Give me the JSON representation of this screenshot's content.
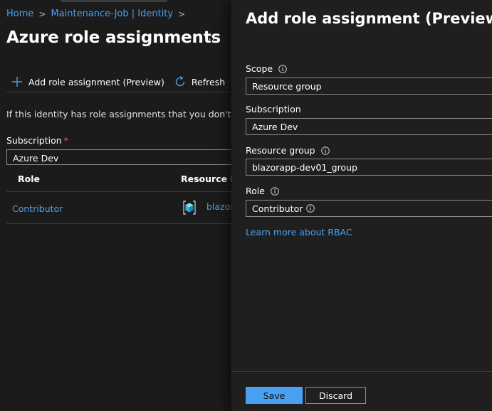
{
  "breadcrumb": {
    "home": "Home",
    "separator": ">",
    "current": "Maintenance-Job | Identity"
  },
  "blade": {
    "title": "Azure role assignments",
    "more": "...",
    "toolbar": {
      "add_label": "Add role assignment (Preview)",
      "refresh_label": "Refresh"
    },
    "info_text": "If this identity has role assignments that you don't have",
    "subscription": {
      "label": "Subscription",
      "required": "*",
      "value": "Azure Dev"
    },
    "table": {
      "columns": [
        "Role",
        "Resource Na"
      ],
      "rows": [
        {
          "role": "Contributor",
          "resource": "blazor"
        }
      ]
    }
  },
  "panel": {
    "title": "Add role assignment (Preview)",
    "fields": [
      {
        "label": "Scope",
        "value": "Resource group",
        "info": true
      },
      {
        "label": "Subscription",
        "value": "Azure Dev",
        "info": false
      },
      {
        "label": "Resource group",
        "value": "blazorapp-dev01_group",
        "info": true
      },
      {
        "label": "Role",
        "value": "Contributor",
        "info": true
      }
    ],
    "learn_more": "Learn more about RBAC",
    "save_label": "Save",
    "discard_label": "Discard"
  },
  "colors": {
    "accent": "#4aa0f0",
    "background": "#1b1b1b",
    "panel": "#1f1f1f",
    "required": "#f05a5a"
  },
  "icons": [
    "chevron-right-icon",
    "plus-icon",
    "refresh-icon",
    "ellipsis-icon",
    "info-icon",
    "resource-cube-icon"
  ]
}
